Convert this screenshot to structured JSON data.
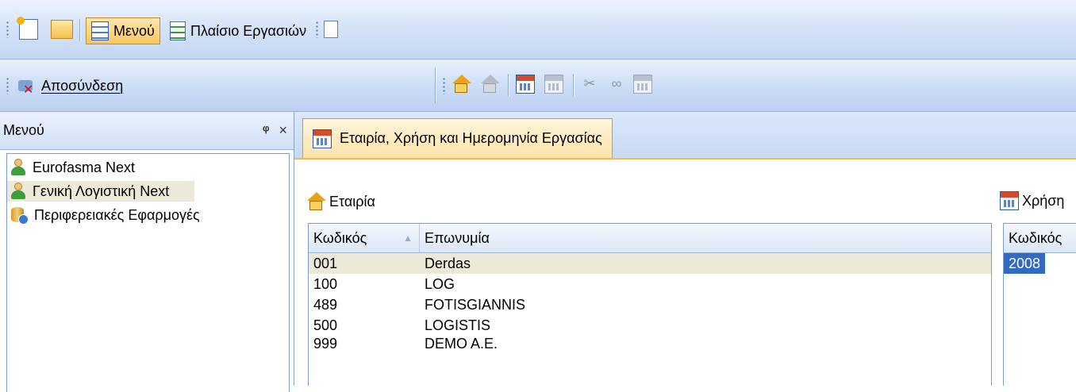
{
  "toolbar1": {
    "menu_label": "Μενού",
    "task_pane_label": "Πλαίσιο Εργασιών"
  },
  "toolbar2": {
    "disconnect_label": "Αποσύνδεση"
  },
  "menu_panel": {
    "title": "Μενού",
    "pin_glyph": "ᵠ",
    "close_glyph": "×",
    "items": [
      {
        "label": "Eurofasma Next",
        "icon": "user-icon"
      },
      {
        "label": "Γενική Λογιστική Next",
        "icon": "user-icon"
      },
      {
        "label": "Περιφερειακές Εφαρμογές",
        "icon": "database-icon"
      }
    ]
  },
  "tab": {
    "label": "Εταιρία, Χρήση και Ημερομηνία Εργασίας"
  },
  "company": {
    "title": "Εταιρία",
    "columns": [
      "Κωδικός",
      "Επωνυμία"
    ],
    "rows": [
      {
        "code": "001",
        "name": "Derdas"
      },
      {
        "code": "100",
        "name": "LOG"
      },
      {
        "code": "489",
        "name": "FOTISGIANNIS"
      },
      {
        "code": "500",
        "name": "LOGISTIS"
      },
      {
        "code": "999",
        "name": "DEMO A.E."
      }
    ]
  },
  "fiscal_year": {
    "title": "Χρήση",
    "columns": [
      "Κωδικός"
    ],
    "rows": [
      {
        "code": "2008"
      }
    ]
  },
  "colors": {
    "toolbar": "#d6e4f8",
    "accent": "#f9c65f",
    "selection": "#ece9d8",
    "highlight": "#316ac5"
  }
}
